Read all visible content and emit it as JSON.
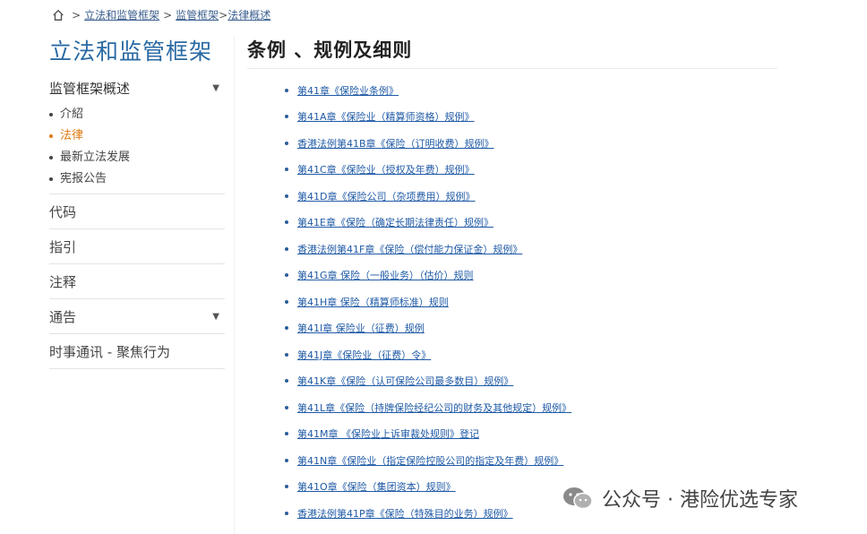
{
  "breadcrumb": {
    "sep": ">",
    "item1": "立法和监管框架",
    "item2": "监管框架",
    "item2_sep": ">",
    "item3": "法律概述"
  },
  "sidebar": {
    "title": "立法和监管框架",
    "section": "监管框架概述",
    "subitems": [
      "介紹",
      "法律",
      "最新立法发展",
      "宪报公告"
    ],
    "active_index": 1,
    "items": [
      "代码",
      "指引",
      "注释",
      "通告",
      "时事通讯 - 聚焦行为"
    ],
    "item_with_caret": 3
  },
  "main": {
    "title": "条例 、规例及细则",
    "ordinances": [
      "第41章《保险业条例》",
      "第41A章《保险业（精算师资格）规例》",
      "香港法例第41B章《保险（订明收费）规例》",
      "第41C章《保险业（授权及年费）规例》",
      "第41D章《保险公司（杂项费用）规例》",
      "第41E章《保险（确定长期法律责任）规例》",
      "香港法例第41F章《保险（偿付能力保证金）规例》",
      "第41G章 保险（一般业务）（估价）规则",
      "第41H章 保险（精算师标准）规则",
      "第41I章 保险业（征费）规例",
      "第41J章《保险业（征费）令》",
      "第41K章《保险（认可保险公司最多数目）规例》",
      "第41L章《保险（持牌保险经纪公司的财务及其他规定）规例》",
      "第41M章 《保险业上诉审裁处规则》登记",
      "第41N章《保险业（指定保险控股公司的指定及年费）规例》",
      "第41O章《保险（集团资本）规则》",
      "香港法例第41P章《保险（特殊目的业务）规例》"
    ]
  },
  "watermark": {
    "text": "公众号 · 港险优选专家",
    "icon": "wechat-icon"
  },
  "colors": {
    "title_blue": "#2a6aa3",
    "link_blue": "#1f5aa6",
    "active_orange": "#e07a10"
  }
}
